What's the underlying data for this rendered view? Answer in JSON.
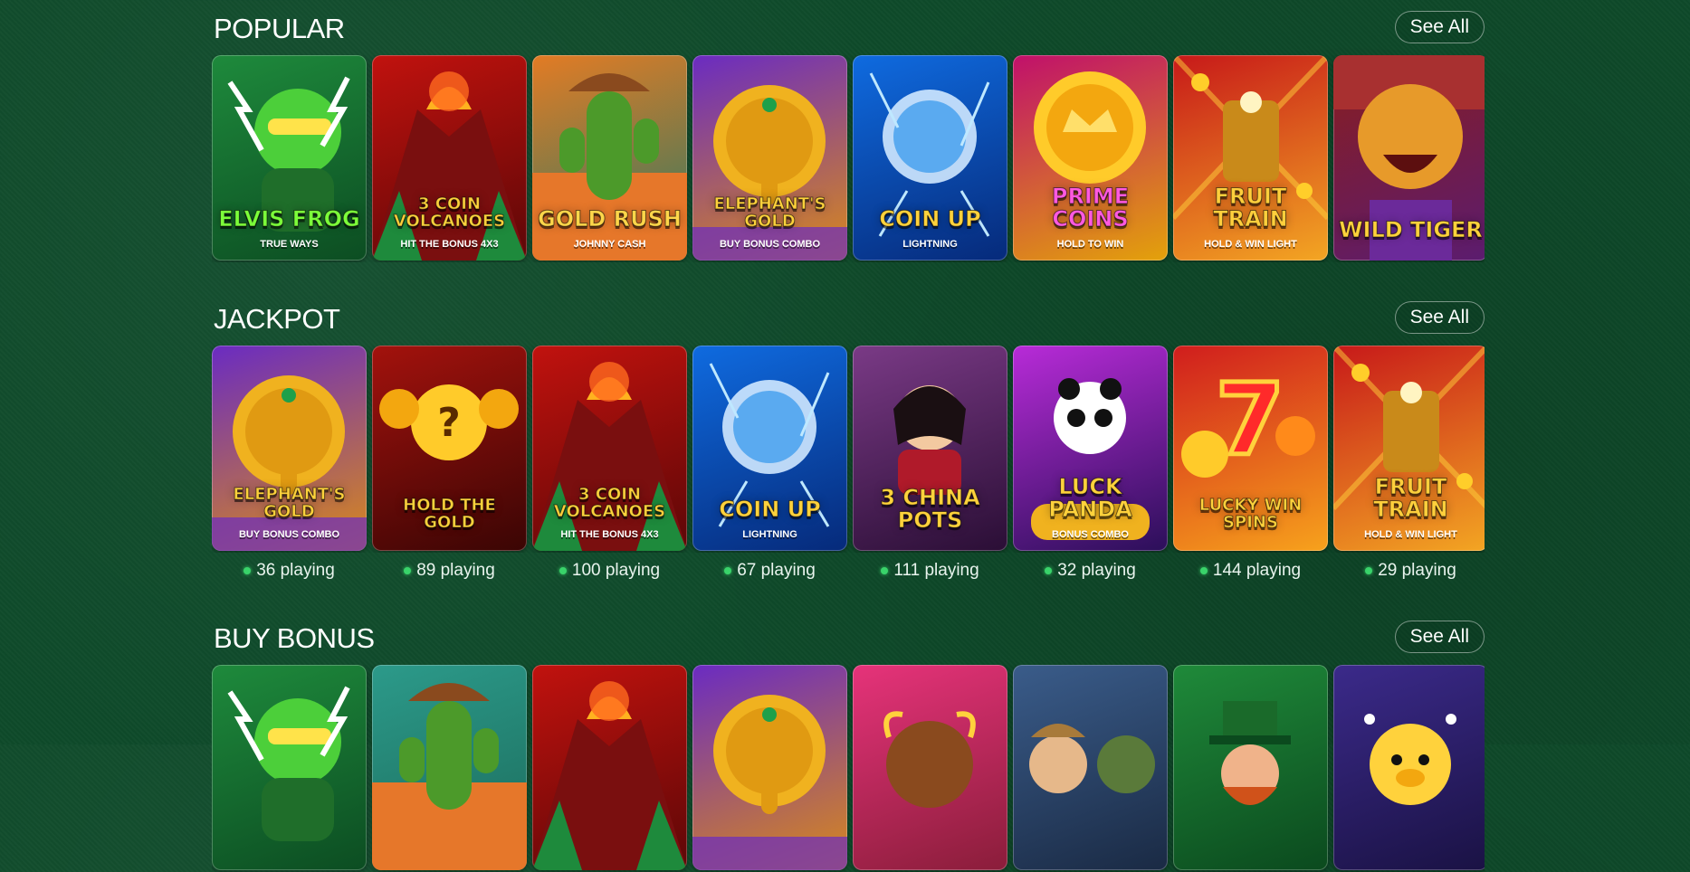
{
  "sections": [
    {
      "title": "POPULAR",
      "see_all": "See All",
      "games": [
        {
          "title": "ELVIS FROG",
          "subtitle": "TRUE WAYS",
          "theme": "frog",
          "bg1": "#1e8a3c",
          "bg2": "#0c4d22",
          "title_color": "#7cff3a",
          "icon": "frog-icon"
        },
        {
          "title": "3 COIN VOLCANOES",
          "subtitle": "HIT the BONUS 4x3",
          "theme": "volcano",
          "bg1": "#c1120e",
          "bg2": "#5c0707",
          "title_color": "#ffd23c",
          "icon": "volcano-icon"
        },
        {
          "title": "GOLD RUSH",
          "subtitle": "JOHNNY CASH",
          "theme": "cactus",
          "bg1": "#e37b24",
          "bg2": "#2c7a63",
          "title_color": "#ffd64a",
          "icon": "cactus-icon"
        },
        {
          "title": "ELEPHANT'S GOLD",
          "subtitle": "BUY BONUS COMBO",
          "theme": "elephant",
          "bg1": "#6a2bc2",
          "bg2": "#d98a1a",
          "title_color": "#ffd23c",
          "icon": "elephant-icon"
        },
        {
          "title": "COIN UP",
          "subtitle": "LIGHTNING",
          "theme": "coin",
          "bg1": "#0f6be0",
          "bg2": "#062a7a",
          "title_color": "#ffd23c",
          "icon": "coin-icon"
        },
        {
          "title": "PRIME COINS",
          "subtitle": "HOLD TO WIN",
          "theme": "crown",
          "bg1": "#c0106b",
          "bg2": "#e3a20a",
          "title_color": "#ff5adf",
          "icon": "crown-icon"
        },
        {
          "title": "FRUIT TRAIN",
          "subtitle": "HOLD & WIN LIGHT",
          "theme": "train",
          "bg1": "#c71919",
          "bg2": "#f3a623",
          "title_color": "#ffcf3c",
          "icon": "train-icon"
        },
        {
          "title": "WILD TIGER",
          "subtitle": "",
          "theme": "tiger",
          "bg1": "#8a1d1d",
          "bg2": "#5b1c6f",
          "title_color": "#ffd23c",
          "icon": "tiger-icon"
        }
      ]
    },
    {
      "title": "JACKPOT",
      "see_all": "See All",
      "games": [
        {
          "title": "ELEPHANT'S GOLD",
          "subtitle": "BUY BONUS COMBO",
          "theme": "elephant",
          "bg1": "#6a2bc2",
          "bg2": "#d98a1a",
          "title_color": "#ffd23c",
          "icon": "elephant-icon",
          "playing": "36 playing"
        },
        {
          "title": "HOLD THE GOLD",
          "subtitle": "",
          "theme": "gold",
          "bg1": "#a3120d",
          "bg2": "#3a0504",
          "title_color": "#ffd23c",
          "icon": "question-icon",
          "playing": "89 playing"
        },
        {
          "title": "3 COIN VOLCANOES",
          "subtitle": "HIT the BONUS 4x3",
          "theme": "volcano",
          "bg1": "#c1120e",
          "bg2": "#5c0707",
          "title_color": "#ffd23c",
          "icon": "volcano-icon",
          "playing": "100 playing"
        },
        {
          "title": "COIN UP",
          "subtitle": "LIGHTNING",
          "theme": "coin",
          "bg1": "#0f6be0",
          "bg2": "#062a7a",
          "title_color": "#ffd23c",
          "icon": "coin-icon",
          "playing": "67 playing"
        },
        {
          "title": "3 CHINA POTS",
          "subtitle": "",
          "theme": "china",
          "bg1": "#7a3a86",
          "bg2": "#2a0e35",
          "title_color": "#ffd23c",
          "icon": "woman-icon",
          "playing": "111 playing"
        },
        {
          "title": "LUCK PANDA",
          "subtitle": "BONUS COMBO",
          "theme": "panda",
          "bg1": "#b82bd8",
          "bg2": "#2b0f59",
          "title_color": "#ffd23c",
          "icon": "panda-icon",
          "playing": "32 playing"
        },
        {
          "title": "LUCKY WIN SPINS",
          "subtitle": "",
          "theme": "seven",
          "bg1": "#d01d1d",
          "bg2": "#f7a21c",
          "title_color": "#ffd23c",
          "icon": "seven-icon",
          "playing": "144 playing"
        },
        {
          "title": "FRUIT TRAIN",
          "subtitle": "HOLD & WIN LIGHT",
          "theme": "train",
          "bg1": "#c71919",
          "bg2": "#f3a623",
          "title_color": "#ffcf3c",
          "icon": "train-icon",
          "playing": "29 playing"
        }
      ]
    },
    {
      "title": "BUY BONUS",
      "see_all": "See All",
      "games": [
        {
          "title": "",
          "subtitle": "",
          "theme": "frog",
          "bg1": "#1e8a3c",
          "bg2": "#0c4d22",
          "title_color": "#7cff3a",
          "icon": "frog-icon"
        },
        {
          "title": "",
          "subtitle": "",
          "theme": "cactus",
          "bg1": "#2c9a8a",
          "bg2": "#1b6a5a",
          "title_color": "#ffd64a",
          "icon": "cactus-icon"
        },
        {
          "title": "",
          "subtitle": "",
          "theme": "volcano",
          "bg1": "#c1120e",
          "bg2": "#5c0707",
          "title_color": "#ffd23c",
          "icon": "volcano-icon"
        },
        {
          "title": "",
          "subtitle": "",
          "theme": "elephant",
          "bg1": "#6a2bc2",
          "bg2": "#d98a1a",
          "title_color": "#ffd23c",
          "icon": "elephant-icon"
        },
        {
          "title": "",
          "subtitle": "",
          "theme": "bison",
          "bg1": "#e6337a",
          "bg2": "#8a1d3a",
          "title_color": "#ffd23c",
          "icon": "bison-icon"
        },
        {
          "title": "",
          "subtitle": "",
          "theme": "warriors",
          "bg1": "#3a5c8a",
          "bg2": "#1a2a44",
          "title_color": "#ffd23c",
          "icon": "orc-icon"
        },
        {
          "title": "",
          "subtitle": "",
          "theme": "leprechaun",
          "bg1": "#1f8a3a",
          "bg2": "#0b4a1e",
          "title_color": "#ffd23c",
          "icon": "leprechaun-icon"
        },
        {
          "title": "",
          "subtitle": "",
          "theme": "pig",
          "bg1": "#3b2a8a",
          "bg2": "#1a1244",
          "title_color": "#ffd23c",
          "icon": "pig-icon"
        }
      ]
    }
  ]
}
